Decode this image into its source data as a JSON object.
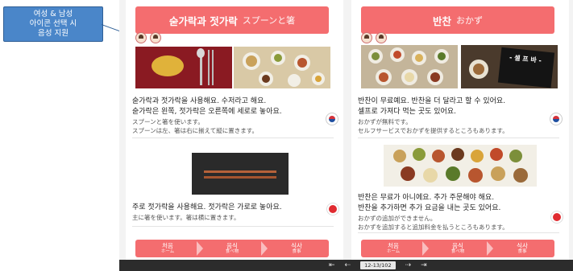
{
  "callout": {
    "text": "여성 & 남성\n아이콘 선택 시\n음성 지원"
  },
  "left_page": {
    "header_ko": "숟가락과 젓가락",
    "header_jp": "スプーンと箸",
    "card1": {
      "ko1": "숟가락과 젓가락을 사용해요. 수저라고 해요.",
      "ko2": "숟가락은 왼쪽, 젓가락은 오른쪽에 세로로 놓아요.",
      "jp1": "スプーンと箸を使います。",
      "jp2": "スプーンは左、箸は右に揃えて縦に置きます。"
    },
    "card2": {
      "ko1": "주로 젓가락을 사용해요. 젓가락은 가로로 놓아요.",
      "jp1": "主に箸を使います。箸は横に置きます。"
    }
  },
  "right_page": {
    "header_ko": "반찬",
    "header_jp": "おかず",
    "sign_text": "- 셀 프 바 -",
    "card1": {
      "ko1": "반찬이 무료예요. 반찬을 더 달라고 할 수 있어요.",
      "ko2": "셀프로 가져다 먹는 곳도 있어요.",
      "jp1": "おかずが無料です。",
      "jp2": "セルフサービスでおかずを提供するところもあります。"
    },
    "card2": {
      "ko1": "반찬은 무료가 아니에요. 추가 주문해야 해요.",
      "ko2": "반찬을 추가하면 추가 요금을 내는 곳도 있어요.",
      "jp1": "おかずの追加ができません。",
      "jp2": "おかずを追加すると追加料金を払うところもあります。"
    }
  },
  "nav": [
    {
      "ko": "처음",
      "jp": "ホーム"
    },
    {
      "ko": "음식",
      "jp": "食べ物"
    },
    {
      "ko": "식사",
      "jp": "食事"
    }
  ],
  "pager": {
    "first": "⇤",
    "prev": "⇠",
    "page": "12-13/102",
    "next": "⇢",
    "last": "⇥"
  },
  "colors": {
    "accent": "#f46d6f",
    "callout": "#4a86c9",
    "footer": "#2c2c2c"
  }
}
